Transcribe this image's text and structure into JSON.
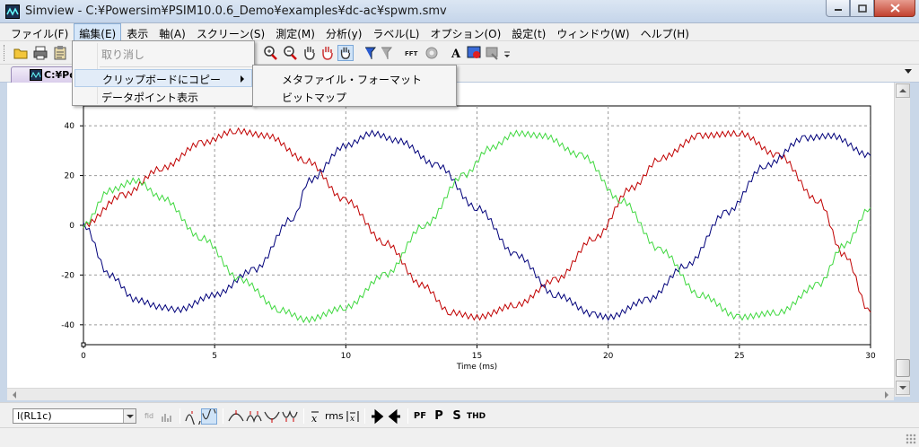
{
  "window": {
    "title": "Simview - C:¥Powersim¥PSIM10.0.6_Demo¥examples¥dc-ac¥spwm.smv"
  },
  "menubar": {
    "items": [
      "ファイル(F)",
      "編集(E)",
      "表示",
      "軸(A)",
      "スクリーン(S)",
      "測定(M)",
      "分析(y)",
      "ラベル(L)",
      "オプション(O)",
      "設定(t)",
      "ウィンドウ(W)",
      "ヘルプ(H)"
    ],
    "active_index": 1
  },
  "edit_menu": {
    "items": [
      {
        "label": "取り消し",
        "disabled": true
      },
      {
        "label": "クリップボードにコピー",
        "submenu": true
      },
      {
        "label": "データポイント表示"
      }
    ],
    "copy_submenu": [
      "メタファイル・フォーマット",
      "ビットマップ"
    ]
  },
  "document_tab": {
    "label": "C:¥Pow"
  },
  "bottom_toolbar": {
    "variable_select": "I(RL1c)",
    "buttons": {
      "fid": "fid",
      "rms": "rms",
      "pf": "PF",
      "p": "P",
      "s": "S",
      "thd": "THD"
    }
  },
  "colors": {
    "series_a": "#c00000",
    "series_b": "#00007a",
    "series_c": "#3fd83f"
  },
  "chart_data": {
    "type": "line",
    "xlabel": "Time (ms)",
    "xlim": [
      0,
      30
    ],
    "ylim": [
      -48,
      48
    ],
    "xticks": [
      0,
      5,
      10,
      15,
      20,
      25,
      30
    ],
    "yticks": [
      -40,
      -20,
      0,
      20,
      40
    ],
    "grid": true,
    "series": [
      {
        "color": "#c00000",
        "x": [
          0,
          1.5,
          3,
          4.5,
          5.8,
          7,
          8.5,
          10,
          11.5,
          12.9,
          14,
          15,
          16.5,
          18,
          19.5,
          20.9,
          22,
          23.5,
          25,
          26.5,
          28,
          29,
          30
        ],
        "y": [
          0,
          12,
          23,
          33,
          38,
          36,
          26,
          10,
          -7,
          -24,
          -35,
          -37,
          -32,
          -22,
          -5,
          15,
          27,
          36,
          37,
          28,
          10,
          -12,
          -35
        ]
      },
      {
        "color": "#00007a",
        "x": [
          0,
          1,
          2,
          3,
          3.6,
          5,
          6.5,
          8,
          8.6,
          10,
          11,
          12,
          13.5,
          15,
          16.5,
          18,
          19.5,
          20,
          21.5,
          23,
          24.5,
          26,
          27.5,
          28.5,
          30
        ],
        "y": [
          0,
          -20,
          -30,
          -33,
          -34,
          -28,
          -18,
          3,
          18,
          32,
          37,
          34,
          24,
          7,
          -12,
          -28,
          -36,
          -37,
          -30,
          -16,
          5,
          24,
          35,
          36,
          28
        ]
      },
      {
        "color": "#3fd83f",
        "x": [
          0,
          1,
          2,
          3,
          4.5,
          6,
          7.5,
          8.5,
          10,
          11.5,
          13,
          14.5,
          15.5,
          16.5,
          17.5,
          19,
          20.5,
          22,
          23.5,
          25,
          26.5,
          28,
          29,
          30
        ],
        "y": [
          0,
          14,
          18,
          11,
          -5,
          -22,
          -34,
          -38,
          -33,
          -20,
          0,
          20,
          31,
          37,
          36,
          28,
          10,
          -10,
          -28,
          -37,
          -35,
          -24,
          -8,
          7
        ]
      }
    ]
  }
}
